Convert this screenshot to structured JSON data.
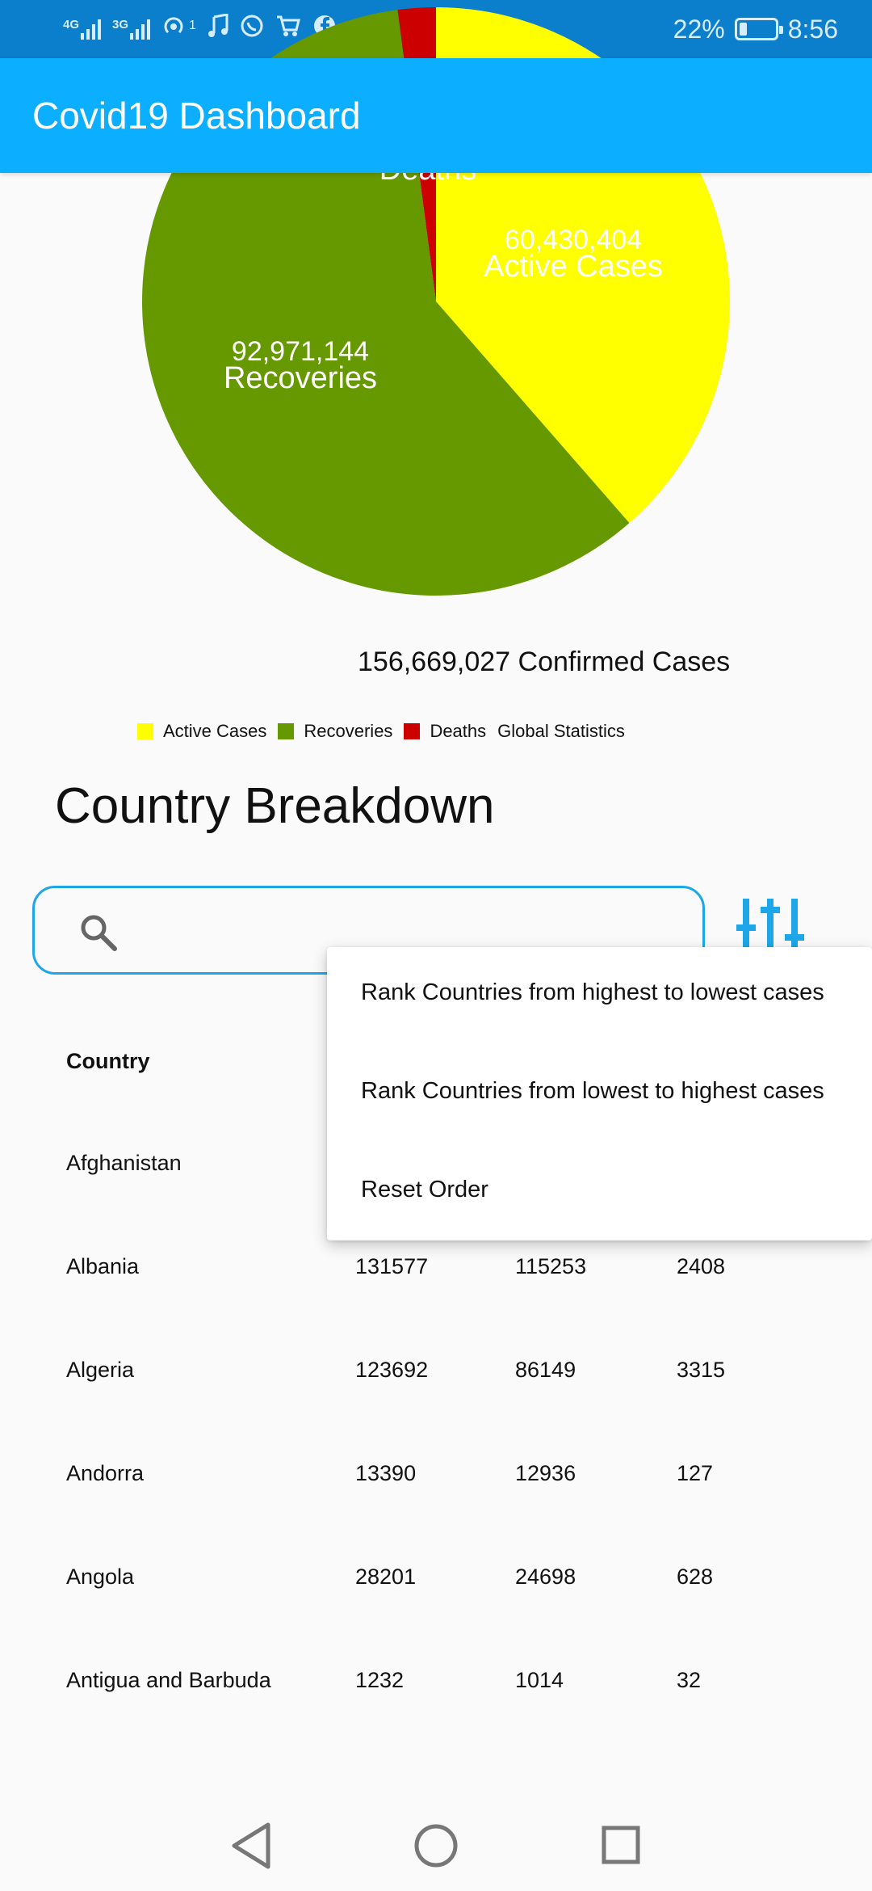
{
  "status_bar": {
    "network_1": "4G",
    "network_2": "3G",
    "hotspot_count": "1",
    "battery_percent": "22%",
    "battery_level": 0.22,
    "time": "8:56",
    "icons": [
      "signal-icon",
      "hotspot-icon",
      "music-icon",
      "whatsapp-icon",
      "cart-icon",
      "facebook-icon",
      "battery-icon"
    ]
  },
  "app_bar": {
    "title": "Covid19 Dashboard"
  },
  "chart_data": {
    "type": "pie",
    "slices": [
      {
        "label": "Active Cases",
        "value": 60430404,
        "display_value": "60,430,404",
        "color": "#ffff00"
      },
      {
        "label": "Recoveries",
        "value": 92971144,
        "display_value": "92,971,144",
        "color": "#669900"
      },
      {
        "label": "Deaths",
        "value": 3267479,
        "display_value": "",
        "color": "#cc0000"
      }
    ],
    "total_label": "156,669,027 Confirmed Cases",
    "legend": [
      "Active Cases",
      "Recoveries",
      "Deaths"
    ],
    "legend_title": "Global Statistics"
  },
  "section_title": "Country Breakdown",
  "search": {
    "placeholder": "",
    "value": ""
  },
  "table": {
    "header": {
      "country": "Country"
    },
    "rows": [
      {
        "country": "Afghanistan",
        "confirmed": "",
        "recovered": "",
        "deaths": ""
      },
      {
        "country": "Albania",
        "confirmed": "131577",
        "recovered": "115253",
        "deaths": "2408"
      },
      {
        "country": "Algeria",
        "confirmed": "123692",
        "recovered": "86149",
        "deaths": "3315"
      },
      {
        "country": "Andorra",
        "confirmed": "13390",
        "recovered": "12936",
        "deaths": "127"
      },
      {
        "country": "Angola",
        "confirmed": "28201",
        "recovered": "24698",
        "deaths": "628"
      },
      {
        "country": "Antigua and Barbuda",
        "confirmed": "1232",
        "recovered": "1014",
        "deaths": "32"
      }
    ]
  },
  "sort_menu": {
    "items": [
      "Rank Countries from highest to lowest cases",
      "Rank Countries from lowest to highest cases",
      "Reset Order"
    ]
  },
  "colors": {
    "status_bar": "#0c7fcc",
    "app_bar": "#0caeff",
    "accent": "#1ea7e8"
  }
}
